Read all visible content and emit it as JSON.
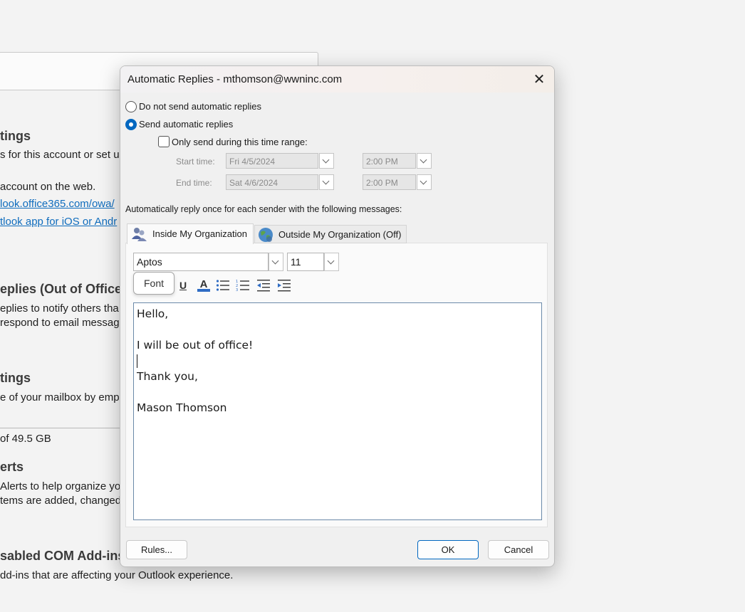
{
  "background": {
    "heading_settings_1": "tings",
    "line_account_setup": "s for this account or set up",
    "line_account_web": " account on the web.",
    "link_owa": "look.office365.com/owa/",
    "link_mobile": "tlook app for iOS or Andr",
    "heading_auto_replies": "eplies (Out of Office",
    "line_notify": "eplies to notify others tha",
    "line_respond": " respond to email messag",
    "heading_settings_2": "tings",
    "line_mailbox": "e of your mailbox by emp",
    "line_storage": "of 49.5 GB",
    "heading_alerts": "erts",
    "line_alerts_1": "Alerts to help organize you",
    "line_alerts_2": "tems are added, changed,",
    "heading_addins": "sabled COM Add-ins",
    "line_addins": "dd-ins that are affecting your Outlook experience."
  },
  "dialog": {
    "title": "Automatic Replies - mthomson@wwninc.com",
    "close_glyph": "✕",
    "option_do_not_send": "Do not send automatic replies",
    "option_send": "Send automatic replies",
    "selected_option": "send",
    "time_range_label": "Only send during this time range:",
    "time_range_checked": false,
    "start_label": "Start time:",
    "start_date": "Fri 4/5/2024",
    "start_time": "2:00 PM",
    "end_label": "End time:",
    "end_date": "Sat 4/6/2024",
    "end_time": "2:00 PM",
    "reply_once_label": "Automatically reply once for each sender with the following messages:",
    "tabs": [
      {
        "label": "Inside My Organization",
        "icon": "people-icon",
        "active": true
      },
      {
        "label": "Outside My Organization (Off)",
        "icon": "globe-icon",
        "active": false
      }
    ],
    "font_name": "Aptos",
    "font_size": "11",
    "font_tooltip": "Font",
    "message_lines": [
      "Hello,",
      "",
      "I will be out of office!",
      "",
      "Thank you,",
      "",
      "Mason Thomson"
    ],
    "rules_button": "Rules...",
    "ok_button": "OK",
    "cancel_button": "Cancel"
  },
  "colors": {
    "accent": "#0067c0",
    "link": "#0f6cbd"
  }
}
